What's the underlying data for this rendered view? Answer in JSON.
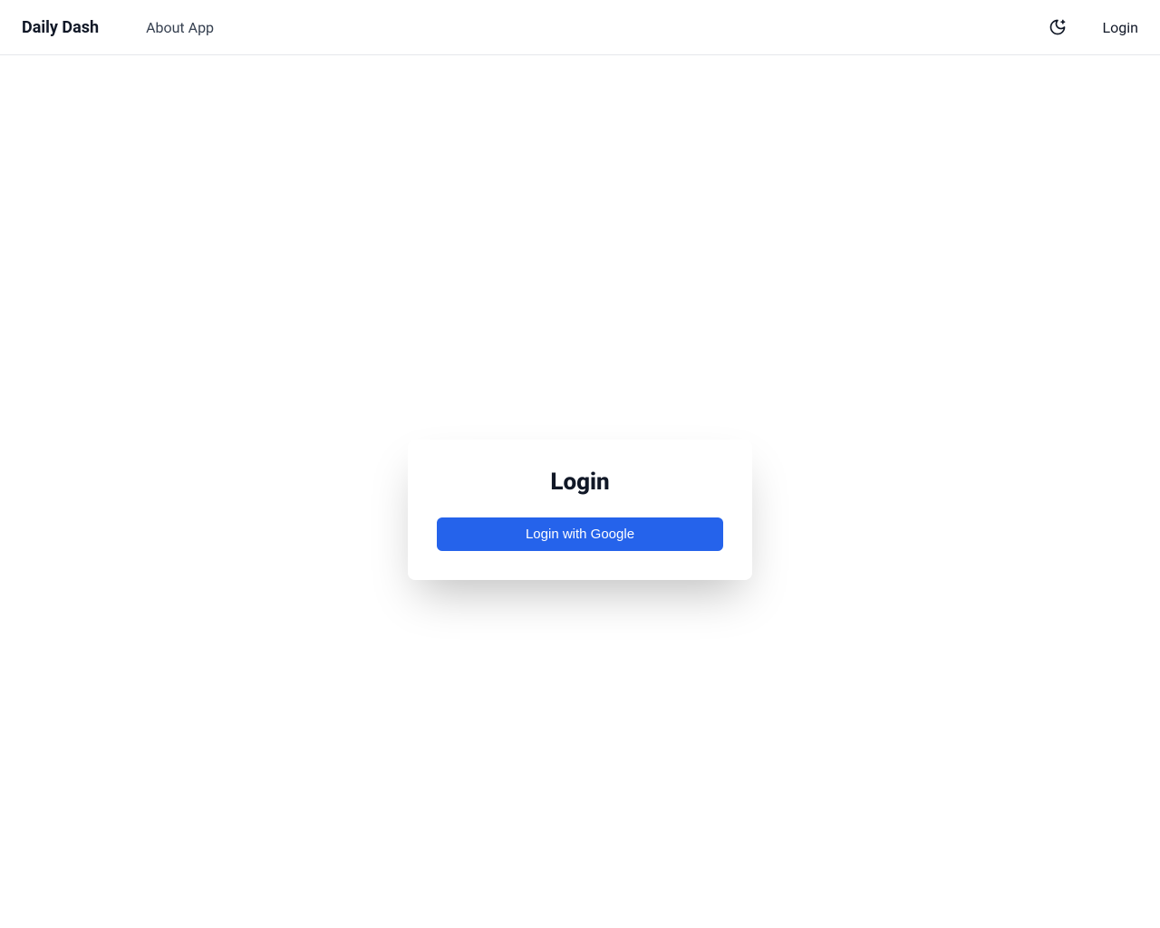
{
  "header": {
    "app_title": "Daily Dash",
    "about_link": "About App",
    "login_link": "Login"
  },
  "login_card": {
    "title": "Login",
    "google_button": "Login with Google"
  }
}
